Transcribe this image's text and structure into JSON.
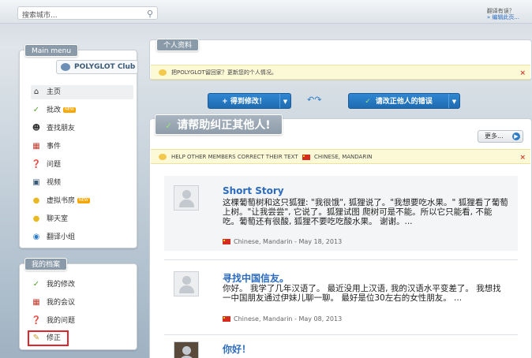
{
  "search": {
    "placeholder": "搜索城市..."
  },
  "help": {
    "question": "翻译有误？",
    "link": "» 编辑此页..."
  },
  "sidebar": {
    "main_menu": {
      "title": "Main menu",
      "logo_text": "POLYGLOT Club",
      "items": [
        {
          "label": "主页",
          "icon": "home-icon"
        },
        {
          "label": "批改",
          "icon": "correct-icon",
          "badge": "NEW"
        },
        {
          "label": "查找朋友",
          "icon": "friends-icon"
        },
        {
          "label": "事件",
          "icon": "calendar-icon"
        },
        {
          "label": "问题",
          "icon": "question-icon"
        },
        {
          "label": "视频",
          "icon": "video-icon"
        },
        {
          "label": "虚拟书房",
          "icon": "bubble-icon",
          "badge": "NEW"
        },
        {
          "label": "聊天室",
          "icon": "bubble-icon"
        },
        {
          "label": "翻译小组",
          "icon": "globe-icon"
        }
      ]
    },
    "my_files": {
      "title": "我的档案",
      "items": [
        {
          "label": "我的修改",
          "icon": "correct-icon"
        },
        {
          "label": "我的会议",
          "icon": "calendar-icon"
        },
        {
          "label": "我的问题",
          "icon": "question-icon"
        },
        {
          "label": "修正",
          "icon": "pencil-icon"
        }
      ]
    }
  },
  "main": {
    "profile": {
      "title": "个人资料",
      "notice": "把POLYGLOT留回家？更新您的个人情况。"
    },
    "buttons": {
      "get_corrections": "+ 得到修改！",
      "correct_others": "请改正他人的错误"
    },
    "help_section": {
      "title": "请帮助纠正其他人!",
      "more": "更多...",
      "notice_prefix": "HELP OTHER MEMBERS CORRECT THEIR TEXT",
      "notice_lang": "CHINESE, MANDARIN",
      "posts": [
        {
          "title": "Short Story",
          "body": "这棵葡萄树和这只狐狸: \"我很饿\", 狐狸说了。\"我想要吃水果。\" 狐狸看了葡萄上树。\"让我尝尝\", 它说了。狐狸试图 爬树可是不能。所以它只能看, 不能吃。葡萄还有很酸, 狐狸不要吃吃酸水果。 谢谢。...",
          "meta": "Chinese, Mandarin - May 18, 2013"
        },
        {
          "title": "寻找中国信友。",
          "body": "你好。 我学了几年汉语了。 最近没用上汉语, 我的汉语水平变差了。 我想找一中国朋友通过伊妹儿聊一聊。 最好是位30左右的女性朋友。 ...",
          "meta": "Chinese, Mandarin - May 08, 2013"
        },
        {
          "title": "你好！"
        }
      ]
    }
  }
}
